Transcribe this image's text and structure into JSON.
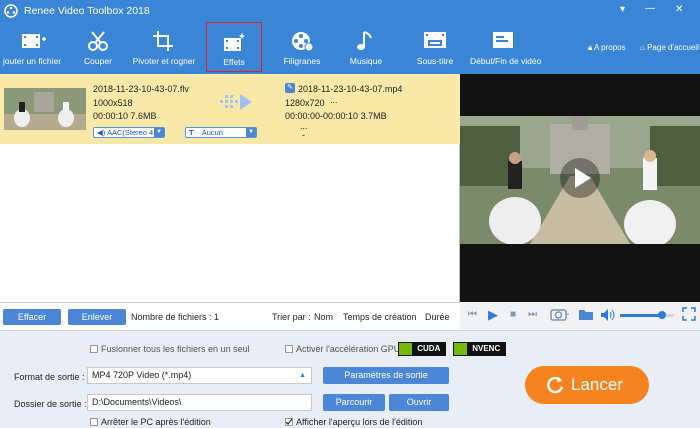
{
  "window": {
    "title": "Renee Video Toolbox 2018",
    "controls": [
      "▾",
      "—",
      "✕"
    ]
  },
  "toolbar": {
    "add_file": "jouter un fichier",
    "cut": "Couper",
    "rotate_crop": "Pivoter et rogner",
    "effects": "Effets",
    "watermarks": "Filigranes",
    "music": "Musique",
    "subtitle": "Sous-titre",
    "start_end": "Début/Fin de vidéo",
    "about": "A propos",
    "home": "Page d'accueil"
  },
  "file": {
    "source_name": "2018-11-23-10-43-07.flv",
    "source_resolution": "1000x518",
    "source_duration_size": "00:00:10  7.6MB",
    "output_name": "2018-11-23-10-43-07.mp4",
    "output_resolution": "1280x720",
    "output_res_extra": "...",
    "output_duration_size": "00:00:00-00:00:10  3.7MB",
    "output_more": "...",
    "audio_track": "AAC(Stereo 4",
    "subtitle_track": "Aucun",
    "dash": "-"
  },
  "listbar": {
    "clear_label": "Effacer",
    "remove_label": "Enlever",
    "file_count": "Nombre de fichiers : 1",
    "sort_by": "Trier par :",
    "sort_name": "Nom",
    "sort_created": "Temps de création",
    "sort_duration": "Durée"
  },
  "player": {
    "volume_level": 0.78
  },
  "settings": {
    "merge_files": "Fusionner tous les fichiers en un seul",
    "gpu_accel": "Activer l'accélération GPU",
    "cuda": "CUDA",
    "nvenc": "NVENC",
    "output_format_label": "Format de sortie :",
    "output_format_value": "MP4 720P Video (*.mp4)",
    "output_params_button": "Paramètres de sortie",
    "output_folder_label": "Dossier de sortie :",
    "output_folder_value": "D:\\Documents\\Videos\\",
    "browse_button": "Parcourir",
    "open_button": "Ouvrir",
    "shutdown_after": "Arrêter le PC après l'édition",
    "preview_while_editing": "Afficher l'aperçu lors de l'édition",
    "preview_checked": true,
    "launch_button": "Lancer"
  },
  "colors": {
    "accent": "#3a85d6",
    "selected_row": "#f8e9a9",
    "launch": "#f5831f",
    "highlight_box": "#e02020",
    "nvidia_green": "#76b900"
  }
}
